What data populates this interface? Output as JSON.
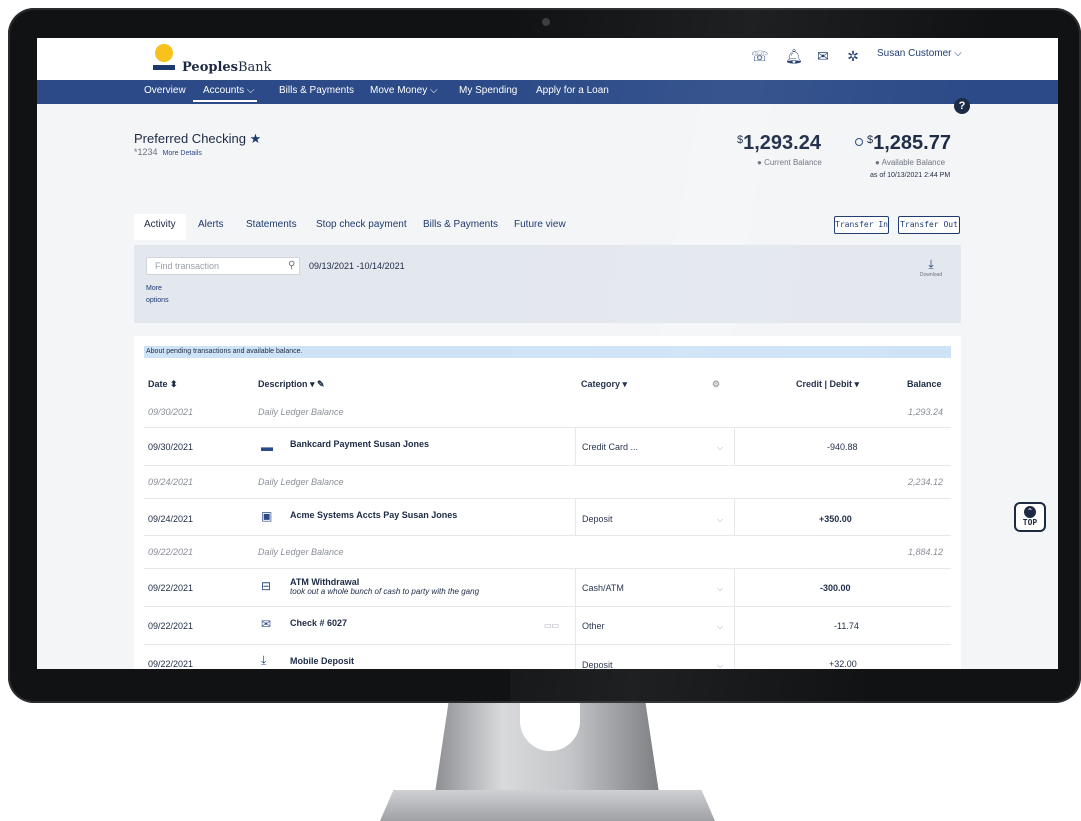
{
  "header": {
    "logo_bold": "Peoples",
    "logo_light": "Bank",
    "icons": [
      "phone-icon",
      "bell-icon",
      "mail-icon",
      "gear-icon"
    ],
    "user": "Susan Customer",
    "user_caret": "⌵"
  },
  "nav": {
    "items": [
      {
        "label": "Overview"
      },
      {
        "label": "Accounts ⌵"
      },
      {
        "label": "Bills & Payments"
      },
      {
        "label": "Move Money ⌵"
      },
      {
        "label": "My Spending"
      },
      {
        "label": "Apply for a Loan"
      }
    ],
    "help": "?"
  },
  "account": {
    "name": "Preferred Checking",
    "number": "*1234",
    "more_details": "More Details",
    "current_currency": "$",
    "current_balance": "1,293.24",
    "current_label": "Current Balance",
    "available_currency": "$",
    "available_balance": "1,285.77",
    "available_label": "Available Balance",
    "as_of": "as of 10/13/2021 2:44 PM"
  },
  "tabs": [
    "Activity",
    "Alerts",
    "Statements",
    "Stop check payment",
    "Bills & Payments",
    "Future view"
  ],
  "actions": {
    "transfer_in": "Transfer In",
    "transfer_out": "Transfer Out"
  },
  "filter": {
    "search_placeholder": "Find transaction",
    "date_range": "09/13/2021 -10/14/2021",
    "more_options_1": "More",
    "more_options_2": "options",
    "download": "Download"
  },
  "notice": "About pending transactions and available balance.",
  "table": {
    "headers": {
      "date": "Date ⬍",
      "description": "Description ▾",
      "category": "Category ▾",
      "credit_debit": "Credit | Debit ▾",
      "balance": "Balance"
    },
    "rows": [
      {
        "type": "ledger",
        "date": "09/30/2021",
        "description": "Daily Ledger Balance",
        "balance": "1,293.24"
      },
      {
        "type": "txn",
        "date": "09/30/2021",
        "icon": "credit-card-icon",
        "description": "Bankcard Payment Susan Jones",
        "memo": "",
        "category": "Credit Card ...",
        "amount": "-940.88",
        "bold_amount": false
      },
      {
        "type": "ledger",
        "date": "09/24/2021",
        "description": "Daily Ledger Balance",
        "balance": "2,234.12"
      },
      {
        "type": "txn",
        "date": "09/24/2021",
        "icon": "briefcase-icon",
        "description": "Acme Systems Accts Pay Susan Jones",
        "memo": "",
        "category": "Deposit",
        "amount": "+350.00",
        "bold_amount": true
      },
      {
        "type": "ledger",
        "date": "09/22/2021",
        "description": "Daily Ledger Balance",
        "balance": "1,884.12"
      },
      {
        "type": "txn",
        "date": "09/22/2021",
        "icon": "atm-icon",
        "description": "ATM Withdrawal",
        "memo": "took out a whole bunch of cash to party with the gang",
        "category": "Cash/ATM",
        "amount": "-300.00",
        "bold_amount": true
      },
      {
        "type": "txn",
        "date": "09/22/2021",
        "icon": "check-icon",
        "description": "Check # 6027",
        "memo": "",
        "category": "Other",
        "amount": "-11.74",
        "bold_amount": false
      },
      {
        "type": "txn",
        "date": "09/22/2021",
        "icon": "mobile-deposit-icon",
        "description": "Mobile Deposit",
        "memo": "",
        "category": "Deposit",
        "amount": "+32.00",
        "bold_amount": false
      }
    ]
  },
  "top_button": "TOP"
}
